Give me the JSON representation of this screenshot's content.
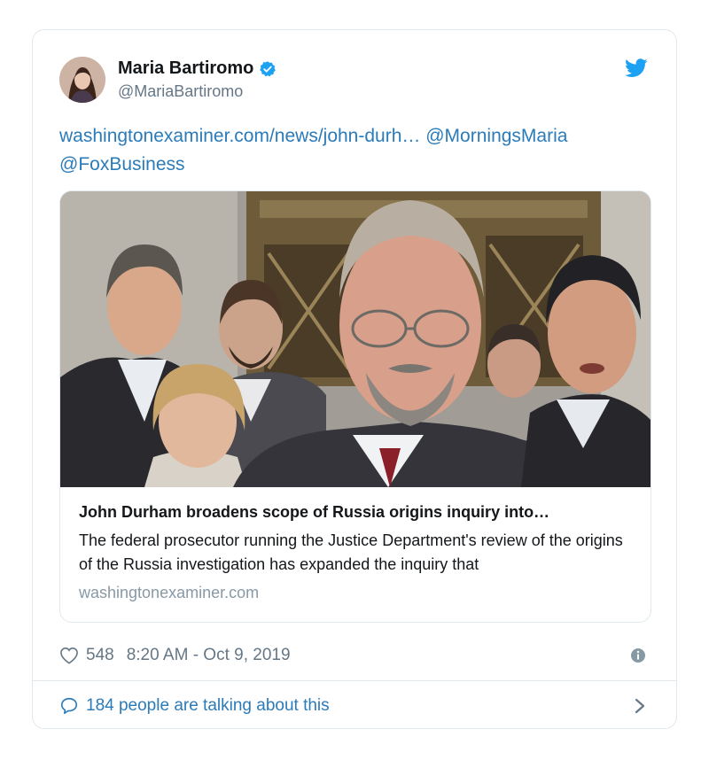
{
  "author": {
    "name": "Maria Bartiromo",
    "handle": "@MariaBartiromo",
    "verified": true
  },
  "tweet": {
    "link_text": "washingtonexaminer.com/news/john-durh…",
    "mention_1": "@MorningsMaria",
    "mention_2": "@FoxBusiness"
  },
  "card": {
    "image_alt": "John Durham with group outside building",
    "title": "John Durham broadens scope of Russia origins inquiry into…",
    "description": "The federal prosecutor running the Justice Department's review of the origins of the Russia investigation has expanded the inquiry that",
    "domain": "washingtonexaminer.com"
  },
  "meta": {
    "likes": "548",
    "timestamp": "8:20 AM - Oct 9, 2019"
  },
  "footer": {
    "talking_text": "184 people are talking about this"
  },
  "icons": {
    "verified": "verified-badge-icon",
    "bird": "twitter-bird-icon",
    "heart": "heart-icon",
    "info": "info-icon",
    "reply": "speech-bubble-icon",
    "chevron": "chevron-right-icon"
  },
  "colors": {
    "link": "#2b7bb9",
    "twitter_blue": "#1da1f2",
    "secondary": "#657786",
    "border": "#e1e8ed"
  }
}
